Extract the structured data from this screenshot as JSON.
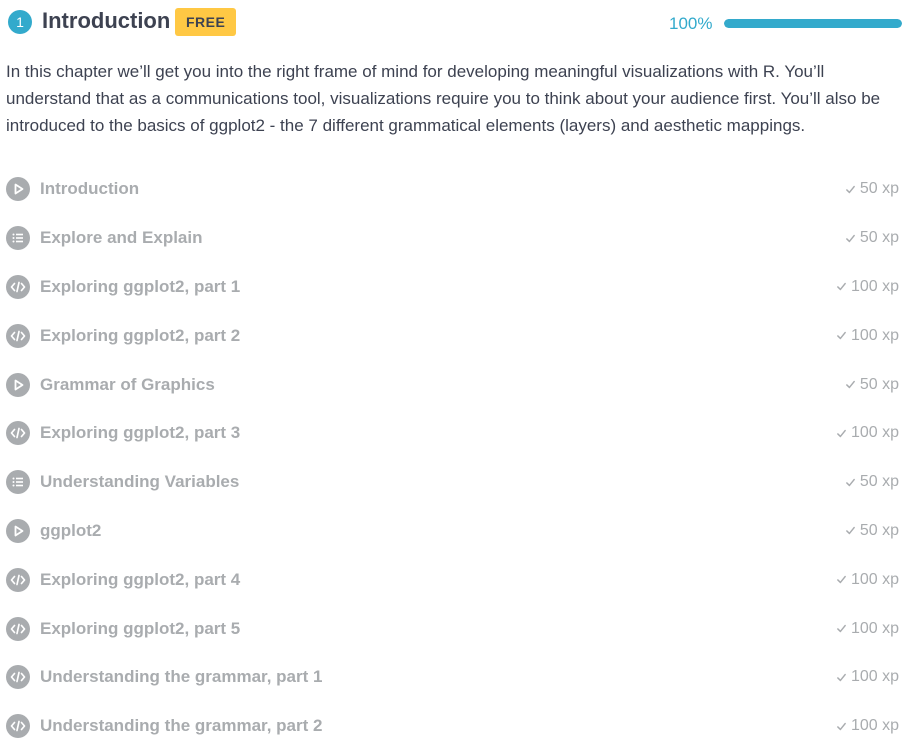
{
  "chapter": {
    "number": "1",
    "title": "Introduction",
    "badge": "FREE",
    "progress_text": "100%",
    "progress_fraction": 1.0,
    "description": "In this chapter we’ll get you into the right frame of mind for developing meaningful visualizations with R. You’ll understand that as a communications tool, visualizations require you to think about your audience first. You’ll also be introduced to the basics of ggplot2 - the 7 different grammatical elements (layers) and aesthetic mappings."
  },
  "colors": {
    "accent": "#33aacc",
    "badge": "#ffc844",
    "muted": "#a9acaf",
    "text": "#3d4251"
  },
  "exercises": [
    {
      "title": "Introduction",
      "xp": "50 xp",
      "icon": "video-icon"
    },
    {
      "title": "Explore and Explain",
      "xp": "50 xp",
      "icon": "list-icon"
    },
    {
      "title": "Exploring ggplot2, part 1",
      "xp": "100 xp",
      "icon": "code-icon"
    },
    {
      "title": "Exploring ggplot2, part 2",
      "xp": "100 xp",
      "icon": "code-icon"
    },
    {
      "title": "Grammar of Graphics",
      "xp": "50 xp",
      "icon": "video-icon"
    },
    {
      "title": "Exploring ggplot2, part 3",
      "xp": "100 xp",
      "icon": "code-icon"
    },
    {
      "title": "Understanding Variables",
      "xp": "50 xp",
      "icon": "list-icon"
    },
    {
      "title": "ggplot2",
      "xp": "50 xp",
      "icon": "video-icon"
    },
    {
      "title": "Exploring ggplot2, part 4",
      "xp": "100 xp",
      "icon": "code-icon"
    },
    {
      "title": "Exploring ggplot2, part 5",
      "xp": "100 xp",
      "icon": "code-icon"
    },
    {
      "title": "Understanding the grammar, part 1",
      "xp": "100 xp",
      "icon": "code-icon"
    },
    {
      "title": "Understanding the grammar, part 2",
      "xp": "100 xp",
      "icon": "code-icon"
    }
  ]
}
